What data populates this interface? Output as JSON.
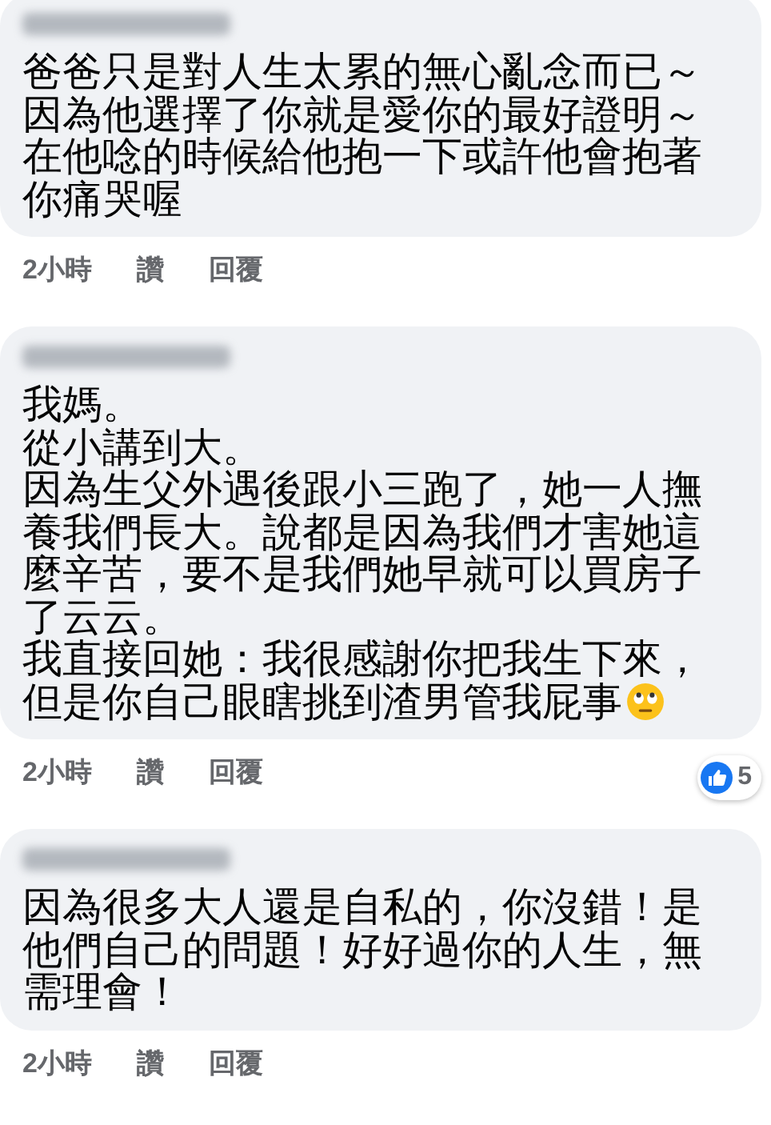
{
  "comments": [
    {
      "paragraphs": [
        "爸爸只是對人生太累的無心亂念而已～",
        "因為他選擇了你就是愛你的最好證明～",
        "在他唸的時候給他抱一下或許他會抱著你痛哭喔"
      ],
      "actions": [
        "2小時",
        "讚",
        "回覆"
      ]
    },
    {
      "paragraphs": [
        "我媽。",
        "從小講到大。",
        "因為生父外遇後跟小三跑了，她一人撫養我們長大。說都是因為我們才害她這麼辛苦，要不是我們她早就可以買房子了云云。",
        "我直接回她：我很感謝你把我生下來，但是你自己眼瞎挑到渣男管我屁事"
      ],
      "ends_with_emoji": true,
      "actions": [
        "2小時",
        "讚",
        "回覆"
      ],
      "reactions": {
        "count": "5"
      }
    },
    {
      "paragraphs": [
        "因為很多大人還是自私的，你沒錯！是他們自己的問題！好好過你的人生，無需理會！"
      ],
      "actions": [
        "2小時",
        "讚",
        "回覆"
      ]
    }
  ]
}
